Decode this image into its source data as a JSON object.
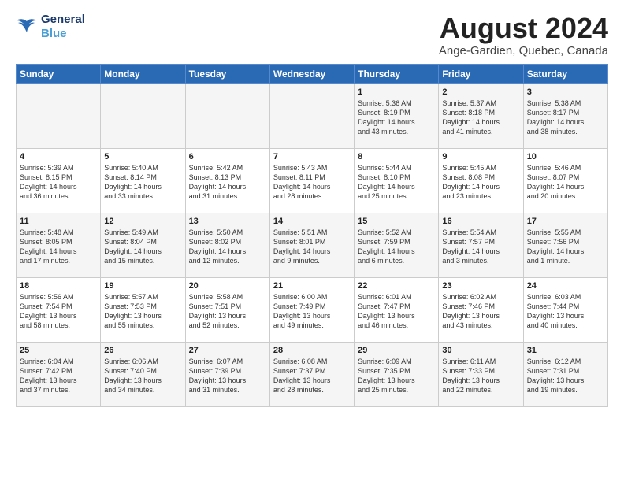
{
  "header": {
    "logo_line1": "General",
    "logo_line2": "Blue",
    "title": "August 2024",
    "subtitle": "Ange-Gardien, Quebec, Canada"
  },
  "columns": [
    "Sunday",
    "Monday",
    "Tuesday",
    "Wednesday",
    "Thursday",
    "Friday",
    "Saturday"
  ],
  "weeks": [
    [
      {
        "day": "",
        "content": ""
      },
      {
        "day": "",
        "content": ""
      },
      {
        "day": "",
        "content": ""
      },
      {
        "day": "",
        "content": ""
      },
      {
        "day": "1",
        "content": "Sunrise: 5:36 AM\nSunset: 8:19 PM\nDaylight: 14 hours\nand 43 minutes."
      },
      {
        "day": "2",
        "content": "Sunrise: 5:37 AM\nSunset: 8:18 PM\nDaylight: 14 hours\nand 41 minutes."
      },
      {
        "day": "3",
        "content": "Sunrise: 5:38 AM\nSunset: 8:17 PM\nDaylight: 14 hours\nand 38 minutes."
      }
    ],
    [
      {
        "day": "4",
        "content": "Sunrise: 5:39 AM\nSunset: 8:15 PM\nDaylight: 14 hours\nand 36 minutes."
      },
      {
        "day": "5",
        "content": "Sunrise: 5:40 AM\nSunset: 8:14 PM\nDaylight: 14 hours\nand 33 minutes."
      },
      {
        "day": "6",
        "content": "Sunrise: 5:42 AM\nSunset: 8:13 PM\nDaylight: 14 hours\nand 31 minutes."
      },
      {
        "day": "7",
        "content": "Sunrise: 5:43 AM\nSunset: 8:11 PM\nDaylight: 14 hours\nand 28 minutes."
      },
      {
        "day": "8",
        "content": "Sunrise: 5:44 AM\nSunset: 8:10 PM\nDaylight: 14 hours\nand 25 minutes."
      },
      {
        "day": "9",
        "content": "Sunrise: 5:45 AM\nSunset: 8:08 PM\nDaylight: 14 hours\nand 23 minutes."
      },
      {
        "day": "10",
        "content": "Sunrise: 5:46 AM\nSunset: 8:07 PM\nDaylight: 14 hours\nand 20 minutes."
      }
    ],
    [
      {
        "day": "11",
        "content": "Sunrise: 5:48 AM\nSunset: 8:05 PM\nDaylight: 14 hours\nand 17 minutes."
      },
      {
        "day": "12",
        "content": "Sunrise: 5:49 AM\nSunset: 8:04 PM\nDaylight: 14 hours\nand 15 minutes."
      },
      {
        "day": "13",
        "content": "Sunrise: 5:50 AM\nSunset: 8:02 PM\nDaylight: 14 hours\nand 12 minutes."
      },
      {
        "day": "14",
        "content": "Sunrise: 5:51 AM\nSunset: 8:01 PM\nDaylight: 14 hours\nand 9 minutes."
      },
      {
        "day": "15",
        "content": "Sunrise: 5:52 AM\nSunset: 7:59 PM\nDaylight: 14 hours\nand 6 minutes."
      },
      {
        "day": "16",
        "content": "Sunrise: 5:54 AM\nSunset: 7:57 PM\nDaylight: 14 hours\nand 3 minutes."
      },
      {
        "day": "17",
        "content": "Sunrise: 5:55 AM\nSunset: 7:56 PM\nDaylight: 14 hours\nand 1 minute."
      }
    ],
    [
      {
        "day": "18",
        "content": "Sunrise: 5:56 AM\nSunset: 7:54 PM\nDaylight: 13 hours\nand 58 minutes."
      },
      {
        "day": "19",
        "content": "Sunrise: 5:57 AM\nSunset: 7:53 PM\nDaylight: 13 hours\nand 55 minutes."
      },
      {
        "day": "20",
        "content": "Sunrise: 5:58 AM\nSunset: 7:51 PM\nDaylight: 13 hours\nand 52 minutes."
      },
      {
        "day": "21",
        "content": "Sunrise: 6:00 AM\nSunset: 7:49 PM\nDaylight: 13 hours\nand 49 minutes."
      },
      {
        "day": "22",
        "content": "Sunrise: 6:01 AM\nSunset: 7:47 PM\nDaylight: 13 hours\nand 46 minutes."
      },
      {
        "day": "23",
        "content": "Sunrise: 6:02 AM\nSunset: 7:46 PM\nDaylight: 13 hours\nand 43 minutes."
      },
      {
        "day": "24",
        "content": "Sunrise: 6:03 AM\nSunset: 7:44 PM\nDaylight: 13 hours\nand 40 minutes."
      }
    ],
    [
      {
        "day": "25",
        "content": "Sunrise: 6:04 AM\nSunset: 7:42 PM\nDaylight: 13 hours\nand 37 minutes."
      },
      {
        "day": "26",
        "content": "Sunrise: 6:06 AM\nSunset: 7:40 PM\nDaylight: 13 hours\nand 34 minutes."
      },
      {
        "day": "27",
        "content": "Sunrise: 6:07 AM\nSunset: 7:39 PM\nDaylight: 13 hours\nand 31 minutes."
      },
      {
        "day": "28",
        "content": "Sunrise: 6:08 AM\nSunset: 7:37 PM\nDaylight: 13 hours\nand 28 minutes."
      },
      {
        "day": "29",
        "content": "Sunrise: 6:09 AM\nSunset: 7:35 PM\nDaylight: 13 hours\nand 25 minutes."
      },
      {
        "day": "30",
        "content": "Sunrise: 6:11 AM\nSunset: 7:33 PM\nDaylight: 13 hours\nand 22 minutes."
      },
      {
        "day": "31",
        "content": "Sunrise: 6:12 AM\nSunset: 7:31 PM\nDaylight: 13 hours\nand 19 minutes."
      }
    ]
  ]
}
